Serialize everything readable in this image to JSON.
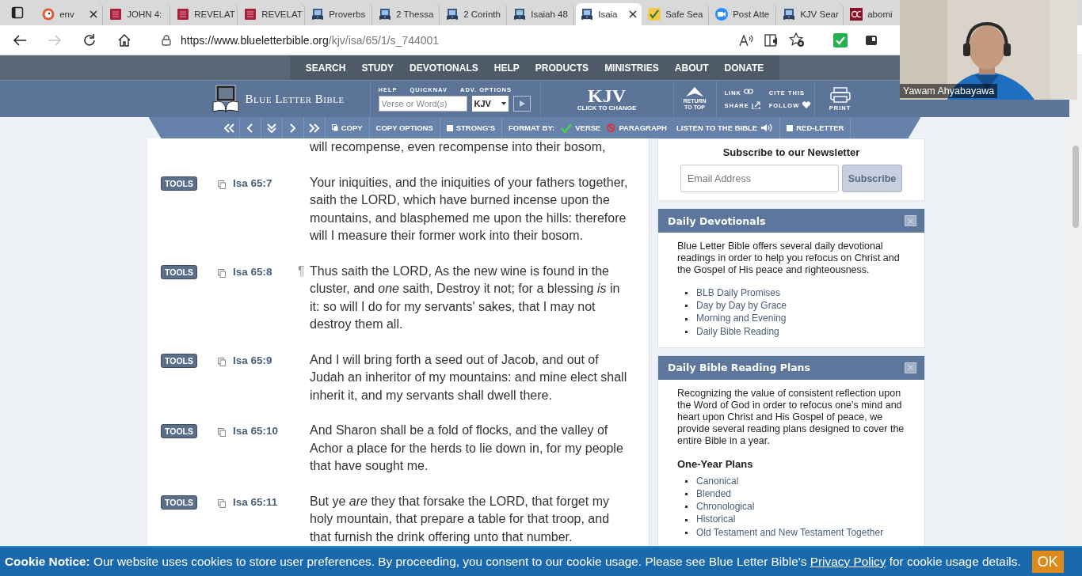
{
  "browser": {
    "tabs": [
      {
        "label": "env",
        "kind": "duck",
        "selected": false,
        "close_button": true
      },
      {
        "label": "JOHN 4:",
        "kind": "book",
        "selected": false,
        "close_button": false
      },
      {
        "label": "REVELAT",
        "kind": "book",
        "selected": false,
        "close_button": false
      },
      {
        "label": "REVELAT",
        "kind": "book",
        "selected": false,
        "close_button": false
      },
      {
        "label": "Proverbs",
        "kind": "bible",
        "selected": false,
        "close_button": false
      },
      {
        "label": "2 Thessa",
        "kind": "bible",
        "selected": false,
        "close_button": false
      },
      {
        "label": "2 Corinth",
        "kind": "bible",
        "selected": false,
        "close_button": false
      },
      {
        "label": "Isaiah 48",
        "kind": "bible",
        "selected": false,
        "close_button": false
      },
      {
        "label": "Isaia",
        "kind": "bible",
        "selected": true,
        "close_button": true
      },
      {
        "label": "Safe Sea",
        "kind": "check",
        "selected": false,
        "close_button": false
      },
      {
        "label": "Post Atte",
        "kind": "camera",
        "selected": false,
        "close_button": false
      },
      {
        "label": "KJV Sear",
        "kind": "bible",
        "selected": false,
        "close_button": false
      },
      {
        "label": "abomi",
        "kind": "emblem",
        "selected": false,
        "close_button": false
      }
    ],
    "url": {
      "host": "https://www.blueletterbible.org",
      "path": "/kjv/isa/65/1/s_744001"
    },
    "forward_disabled": true
  },
  "site": {
    "nav": [
      "SEARCH",
      "STUDY",
      "DEVOTIONALS",
      "HELP",
      "PRODUCTS",
      "MINISTRIES",
      "ABOUT",
      "DONATE"
    ],
    "header": {
      "logo": "Blue Letter Bible",
      "form_labels": [
        "HELP",
        "QUICKNAV",
        "ADV. OPTIONS"
      ],
      "search_placeholder": "Verse or Word(s)",
      "version": "KJV",
      "big_version": "KJV",
      "click_to_change": "CLICK TO CHANGE",
      "return_to_top": "RETURN TO TOP",
      "links": [
        {
          "label": "LINK",
          "kind": "chain"
        },
        {
          "label": "CITE THIS",
          "kind": "text"
        },
        {
          "label": "SHARE",
          "kind": "share"
        },
        {
          "label": "FOLLOW",
          "kind": "heart"
        }
      ],
      "print": "PRINT"
    },
    "toolbar": [
      {
        "kind": "first"
      },
      {
        "kind": "prev"
      },
      {
        "kind": "down"
      },
      {
        "kind": "next"
      },
      {
        "kind": "last"
      },
      {
        "kind": "copy",
        "label": "COPY"
      },
      {
        "kind": "button",
        "label": "COPY OPTIONS"
      },
      {
        "kind": "checkbox",
        "label": "STRONG'S",
        "checked": false
      },
      {
        "kind": "label",
        "label": "FORMAT BY:"
      },
      {
        "kind": "option",
        "label": "VERSE",
        "selected": true
      },
      {
        "kind": "option",
        "label": "PARAGRAPH",
        "selected": false
      },
      {
        "kind": "listen",
        "label": "LISTEN TO THE BIBLE"
      },
      {
        "kind": "checkbox",
        "label": "RED-LETTER",
        "checked": false
      }
    ]
  },
  "verses": {
    "lead_text": "will recompense, even recompense into their bosom,",
    "items": [
      {
        "tools": "TOOLS",
        "ref": "Isa 65:7",
        "text": "Your iniquities, and the iniquities of your fathers together, saith the LORD, which have burned incense upon the mountains, and blasphemed me upon the hills: therefore will I measure their former work into their bosom."
      },
      {
        "tools": "TOOLS",
        "ref": "Isa 65:8",
        "pilcrow": "¶",
        "text": "Thus saith the LORD, As the new wine is found in the cluster, and *one* saith, Destroy it not; for a blessing *is* in it: so will I do for my servants' sakes, that I may not destroy them all."
      },
      {
        "tools": "TOOLS",
        "ref": "Isa 65:9",
        "text": "And I will bring forth a seed out of Jacob, and out of Judah an inheritor of my mountains: and mine elect shall inherit it, and my servants shall dwell there."
      },
      {
        "tools": "TOOLS",
        "ref": "Isa 65:10",
        "text": "And Sharon shall be a fold of flocks, and the valley of Achor a place for the herds to lie down in, for my people that have sought me."
      },
      {
        "tools": "TOOLS",
        "ref": "Isa 65:11",
        "text": "But ye *are* they that forsake the LORD, that forget my holy mountain, that prepare a table for that troop, and that furnish the drink offering unto that number."
      }
    ]
  },
  "sidebar": {
    "newsletter": {
      "title": "Subscribe to our Newsletter",
      "placeholder": "Email Address",
      "button": "Subscribe"
    },
    "cards": [
      {
        "title": "Daily Devotionals",
        "intro": "Blue Letter Bible offers several daily devotional readings in order to help you refocus on Christ and the Gospel of His peace and righteousness.",
        "links": [
          "BLB Daily Promises",
          "Day by Day by Grace",
          "Morning and Evening",
          "Daily Bible Reading"
        ]
      },
      {
        "title": "Daily Bible Reading Plans",
        "intro": "Recognizing the value of consistent reflection upon the Word of God in order to refocus one's mind and heart upon Christ and His Gospel of peace, we provide several reading plans designed to cover the entire Bible in a year.",
        "subheading": "One-Year Plans",
        "links": [
          "Canonical",
          "Blended",
          "Chronological",
          "Historical",
          "Old Testament and New Testament Together"
        ]
      }
    ]
  },
  "cookie_notice": {
    "text": "**Cookie Notice:** Our website uses cookies to store user preferences. By proceeding, you consent to our cookie usage. Please see Blue Letter Bible's",
    "link": "Privacy Policy",
    "text_after": "for cookie usage details.",
    "button": "OK"
  },
  "webcam": {
    "kind": "picture",
    "name": "Yawam Ahyabayawa"
  }
}
